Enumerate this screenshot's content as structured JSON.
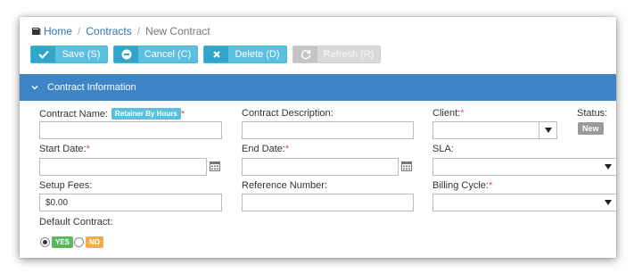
{
  "breadcrumb": {
    "home": "Home",
    "contracts": "Contracts",
    "current": "New Contract"
  },
  "toolbar": {
    "save_label": "Save (S)",
    "cancel_label": "Cancel (C)",
    "delete_label": "Delete (D)",
    "refresh_label": "Refresh (R)"
  },
  "section": {
    "title": "Contract Information"
  },
  "form": {
    "contract_name_label": "Contract Name:",
    "contract_type_badge": "Retainer By Hours",
    "contract_description_label": "Contract Description:",
    "client_label": "Client:",
    "status_label": "Status:",
    "status_value": "New",
    "start_date_label": "Start Date:",
    "end_date_label": "End Date:",
    "sla_label": "SLA:",
    "setup_fees_label": "Setup Fees:",
    "setup_fees_value": "$0.00",
    "reference_number_label": "Reference Number:",
    "billing_cycle_label": "Billing Cycle:",
    "default_contract_label": "Default Contract:",
    "yes_label": "YES",
    "no_label": "NO",
    "required_mark": "*"
  },
  "colors": {
    "section_header": "#3d85c6",
    "button_info": "#5bc0de",
    "required": "#d9534f",
    "yes_badge": "#5cb85c",
    "no_badge": "#f0ad4e"
  }
}
